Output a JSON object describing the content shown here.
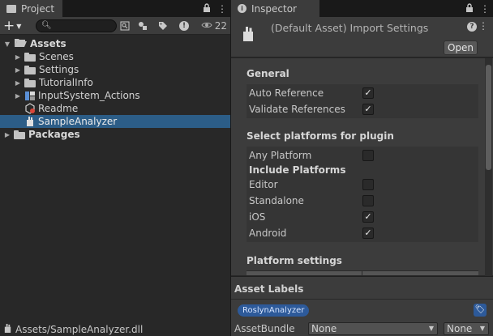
{
  "project": {
    "tab_label": "Project",
    "hidden_count": "22",
    "tree": [
      {
        "label": "Assets",
        "icon": "folder-open-icon"
      },
      {
        "label": "Scenes",
        "icon": "folder-icon"
      },
      {
        "label": "Settings",
        "icon": "folder-icon"
      },
      {
        "label": "TutorialInfo",
        "icon": "folder-icon"
      },
      {
        "label": "InputSystem_Actions",
        "icon": "input-actions-icon"
      },
      {
        "label": "Readme",
        "icon": "readme-asset-icon"
      },
      {
        "label": "SampleAnalyzer",
        "icon": "dll-plugin-icon"
      },
      {
        "label": "Packages",
        "icon": "folder-icon"
      }
    ],
    "status_path": "Assets/SampleAnalyzer.dll"
  },
  "inspector": {
    "tab_label": "Inspector",
    "title": "(Default Asset) Import Settings",
    "open_label": "Open",
    "general": {
      "title": "General",
      "auto_reference": {
        "label": "Auto Reference",
        "checked": true
      },
      "validate_references": {
        "label": "Validate References",
        "checked": true
      }
    },
    "platforms": {
      "title": "Select platforms for plugin",
      "any_platform": {
        "label": "Any Platform",
        "checked": false
      },
      "include_label": "Include Platforms",
      "items": [
        {
          "label": "Editor",
          "checked": false
        },
        {
          "label": "Standalone",
          "checked": false
        },
        {
          "label": "iOS",
          "checked": true
        },
        {
          "label": "Android",
          "checked": true
        }
      ]
    },
    "platform_settings_title": "Platform settings",
    "asset_labels": {
      "title": "Asset Labels",
      "chip": "RoslynAnalyzer"
    },
    "asset_bundle": {
      "label": "AssetBundle",
      "value": "None",
      "variant": "None"
    }
  },
  "colors": {
    "selection": "#2c5d87",
    "label_chip": "#2d5a9a"
  }
}
